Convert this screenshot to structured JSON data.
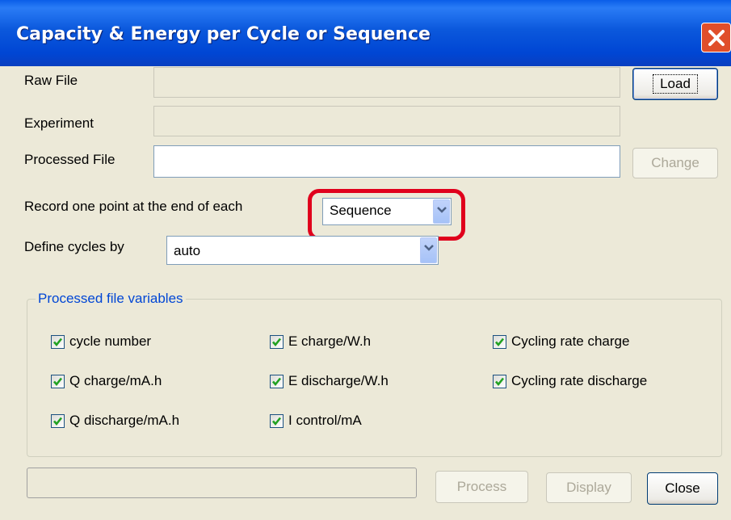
{
  "window": {
    "title": "Capacity & Energy per Cycle or Sequence"
  },
  "form": {
    "raw_file_label": "Raw File",
    "raw_file_value": "",
    "load_button": "Load",
    "experiment_label": "Experiment",
    "experiment_value": "",
    "processed_file_label": "Processed File",
    "processed_file_value": "",
    "change_button": "Change",
    "record_label": "Record one point at the end of each",
    "record_value": "Sequence",
    "define_cycles_label": "Define cycles by",
    "define_cycles_value": "auto"
  },
  "variables": {
    "title": "Processed file variables",
    "items": [
      {
        "label": "cycle number",
        "checked": true
      },
      {
        "label": "Q charge/mA.h",
        "checked": true
      },
      {
        "label": "Q discharge/mA.h",
        "checked": true
      },
      {
        "label": "E charge/W.h",
        "checked": true
      },
      {
        "label": "E discharge/W.h",
        "checked": true
      },
      {
        "label": "I control/mA",
        "checked": true
      },
      {
        "label": "Cycling rate charge",
        "checked": true
      },
      {
        "label": "Cycling rate discharge",
        "checked": true
      }
    ]
  },
  "footer": {
    "progress": 0,
    "process_button": "Process",
    "display_button": "Display",
    "close_button": "Close"
  },
  "colors": {
    "highlight": "#e0001c",
    "title_bar": "#0046d4",
    "group_title": "#0046d5"
  }
}
